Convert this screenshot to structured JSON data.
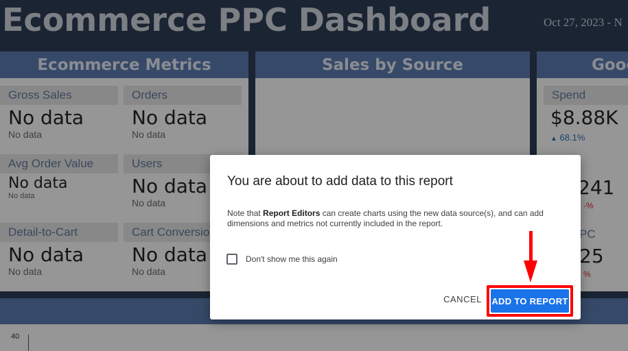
{
  "dashboard": {
    "title": "Ecommerce PPC Dashboard",
    "date": "Oct 27, 2023 - N"
  },
  "panels": {
    "ecommerce": {
      "title": "Ecommerce Metrics",
      "metrics": [
        {
          "label": "Gross Sales",
          "value": "No data",
          "sub": "No data"
        },
        {
          "label": "Orders",
          "value": "No data",
          "sub": "No data"
        },
        {
          "label": "Avg Order Value",
          "value": "No data",
          "sub": "No data"
        },
        {
          "label": "Users",
          "value": "No data",
          "sub": "No data"
        },
        {
          "label": "Detail-to-Cart",
          "value": "No data",
          "sub": "No data"
        },
        {
          "label": "Cart Conversion",
          "value": "No data",
          "sub": "No data"
        }
      ]
    },
    "sales_by_source": {
      "title": "Sales by Source"
    },
    "google": {
      "title": "Goog",
      "spend_label": "Spend",
      "spend_value": "$8.88K",
      "spend_delta": "68.1%",
      "frag_value_2": "241",
      "frag_label_3": "PC",
      "frag_value_3": "25"
    }
  },
  "chart": {
    "axis_tick": "40"
  },
  "dialog": {
    "title": "You are about to add data to this report",
    "note_prefix": "Note that ",
    "note_bold": "Report Editors",
    "note_rest": " can create charts using the new data source(s), and can add dimensions and metrics not currently included in the report.",
    "checkbox_label": "Don't show me this again",
    "checkbox_checked": false,
    "cancel_label": "CANCEL",
    "add_label": "ADD TO REPORT"
  },
  "colors": {
    "primary_button": "#1a73e8",
    "highlight": "#ff0000",
    "panel_header": "#5877a8",
    "background": "#2b3a52"
  }
}
